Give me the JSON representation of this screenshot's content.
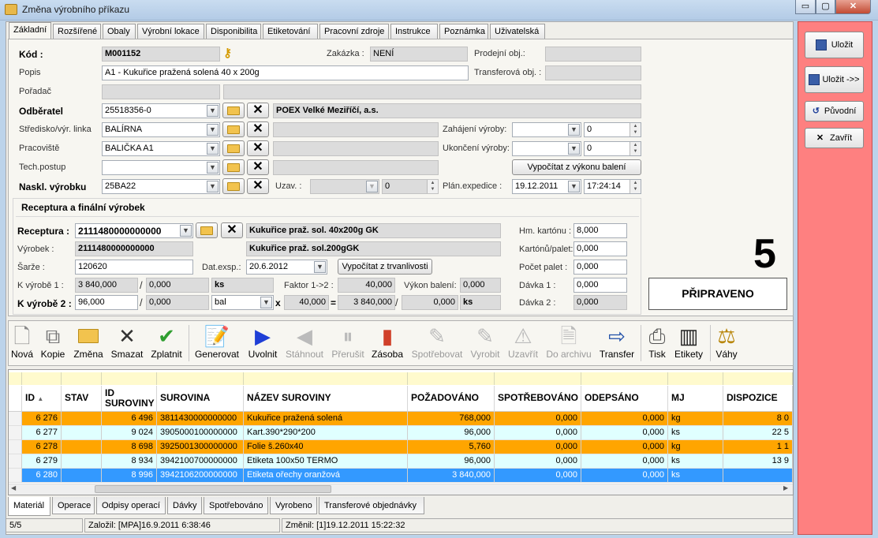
{
  "window": {
    "title": "Změna výrobního příkazu",
    "min": "▭",
    "max": "▢",
    "close": "✕"
  },
  "tabs": [
    "Základní",
    "Rozšířené",
    "Obaly",
    "Výrobní lokace",
    "Disponibilita",
    "Etiketování",
    "Pracovní zdroje",
    "Instrukce",
    "Poznámka",
    "Uživatelská"
  ],
  "form": {
    "kod_label": "Kód :",
    "kod": "M001152",
    "zakazka_label": "Zakázka :",
    "zakazka": "NENÍ",
    "prodejni_label": "Prodejní obj.:",
    "prodejni": "",
    "popis_label": "Popis",
    "popis": "A1 - Kukuřice pražená solená 40 x 200g",
    "transfer_label": "Transferová obj. :",
    "transfer": "",
    "poradac_label": "Pořadač",
    "poradac": "",
    "odberatel_label": "Odběratel",
    "odberatel": "25518356-0",
    "odberatel_name": "POEX Velké Meziříčí, a.s.",
    "stredisko_label": "Středisko/výr. linka",
    "stredisko": "BALÍRNA",
    "pracoviste_label": "Pracoviště",
    "pracoviste": "BALIČKA A1",
    "techpostup_label": "Tech.postup",
    "techpostup": "",
    "naskl_label": "Naskl. výrobku",
    "naskl": "25BA22",
    "zahajeni_label": "Zahájení výroby:",
    "zahajeni_date": "",
    "zahajeni_num": "0",
    "ukonceni_label": "Ukončení výroby:",
    "ukonceni_date": "",
    "ukonceni_num": "0",
    "vypocitat_vykon": "Vypočítat z výkonu balení",
    "uzav_label": "Uzav. :",
    "uzav": "",
    "uzav_num": "0",
    "planexp_label": "Plán.expedice :",
    "planexp_date": "19.12.2011",
    "planexp_time": "17:24:14"
  },
  "receptura": {
    "section_title": "Receptura a finální výrobek",
    "receptura_label": "Receptura :",
    "receptura": "2111480000000000",
    "receptura_name": "Kukuřice praž. sol. 40x200g GK",
    "vyrobek_label": "Výrobek :",
    "vyrobek": "2111480000000000",
    "vyrobek_name": "Kukuřice praž. sol.200gGK",
    "sarze_label": "Šarže :",
    "sarze": "120620",
    "datexp_label": "Dat.exsp.:",
    "datexp": "20.6.2012",
    "vypocitat_trv": "Vypočítat z trvanlivosti",
    "kvyrobe1_label": "K výrobě 1 :",
    "kvyrobe1": "3 840,000",
    "kvyrobe1_b": "0,000",
    "kvyrobe1_mj": "ks",
    "faktor_label": "Faktor 1->2 :",
    "faktor": "40,000",
    "vykon_label": "Výkon balení:",
    "vykon": "0,000",
    "kvyrobe2_label": "K výrobě 2 :",
    "kvyrobe2": "96,000",
    "kvyrobe2_b": "0,000",
    "kvyrobe2_mj": "bal",
    "mult_sign": "x",
    "mult_val": "40,000",
    "eq_sign": "=",
    "eq_val": "3 840,000",
    "eq_b": "0,000",
    "eq_mj": "ks",
    "slash": "/",
    "hmkarton_label": "Hm. kartónu :",
    "hmkarton": "8,000",
    "kartonu_label": "Kartónů/palet:",
    "kartonu": "0,000",
    "pocet_label": "Počet palet :",
    "pocet": "0,000",
    "davka1_label": "Dávka 1 :",
    "davka1": "0,000",
    "davka2_label": "Dávka 2 :",
    "davka2": "0,000"
  },
  "status": {
    "number": "5",
    "text": "PŘIPRAVENO"
  },
  "toolbar": [
    "Nová",
    "Kopie",
    "Změna",
    "Smazat",
    "Zplatnit",
    "Generovat",
    "Uvolnit",
    "Stáhnout",
    "Přerušit",
    "Zásoba",
    "Spotřebovat",
    "Vyrobit",
    "Uzavřít",
    "Do archivu",
    "Transfer",
    "Tisk",
    "Etikety",
    "Váhy"
  ],
  "grid": {
    "headers": [
      "ID",
      "STAV",
      "ID SUROVINY",
      "SUROVINA",
      "NÁZEV SUROVINY",
      "POŽADOVÁNO",
      "SPOTŘEBOVÁNO",
      "ODEPSÁNO",
      "MJ",
      "DISPOZICE"
    ],
    "rows": [
      [
        "6 276",
        "",
        "6 496",
        "3811430000000000",
        "Kukuřice pražená solená",
        "768,000",
        "0,000",
        "0,000",
        "kg",
        "8 0"
      ],
      [
        "6 277",
        "",
        "9 024",
        "3905000100000000",
        "Kart.390*290*200",
        "96,000",
        "0,000",
        "0,000",
        "ks",
        "22 5"
      ],
      [
        "6 278",
        "",
        "8 698",
        "3925001300000000",
        "Folie š.260x40",
        "5,760",
        "0,000",
        "0,000",
        "kg",
        "1 1"
      ],
      [
        "6 279",
        "",
        "8 934",
        "3942100700000000",
        "Etiketa 100x50    TERMO",
        "96,000",
        "0,000",
        "0,000",
        "ks",
        "13 9"
      ],
      [
        "6 280",
        "",
        "8 996",
        "3942106200000000",
        "Etiketa ořechy   oranžová",
        "3 840,000",
        "0,000",
        "0,000",
        "ks",
        ""
      ]
    ]
  },
  "bottom_tabs": [
    "Materiál",
    "Operace",
    "Odpisy operací",
    "Dávky",
    "Spotřebováno",
    "Vyrobeno",
    "Transferové objednávky"
  ],
  "statusbar": {
    "count": "5/5",
    "created": "Založil: [MPA]16.9.2011 6:38:46",
    "changed": "Změnil: [1]19.12.2011 15:22:32"
  },
  "actions": {
    "save": "Uložit",
    "save_next": "Uložit ->>",
    "original": "Původní",
    "close": "Zavřít"
  },
  "colors": {
    "row_orange": "#ffa500",
    "row_cyan": "#e0ffff",
    "row_selected": "#3399ff",
    "side_panel": "#fe8080"
  }
}
